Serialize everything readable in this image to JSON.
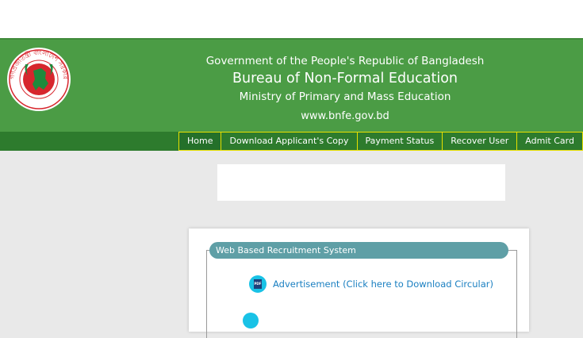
{
  "header": {
    "line1": "Government of the People's Republic of Bangladesh",
    "line2": "Bureau of Non-Formal Education",
    "line3": "Ministry of Primary and Mass Education",
    "website": "www.bnfe.gov.bd",
    "seal_text": "গণপ্রজাতন্ত্রী বাংলাদেশ সরকার"
  },
  "nav": {
    "items": [
      {
        "label": "Home"
      },
      {
        "label": "Download Applicant's Copy"
      },
      {
        "label": "Payment Status"
      },
      {
        "label": "Recover User"
      },
      {
        "label": "Admit Card"
      }
    ]
  },
  "panel": {
    "legend": "Web Based Recruitment System",
    "advertisement_link": "Advertisement (Click here to Download Circular)",
    "pdf_icon_text": "PDF"
  },
  "colors": {
    "header_green": "#4b9c45",
    "nav_green": "#2d7b2d",
    "nav_border": "#e8e000",
    "legend_teal": "#5f9fa6",
    "link_blue": "#1a7fc1"
  }
}
